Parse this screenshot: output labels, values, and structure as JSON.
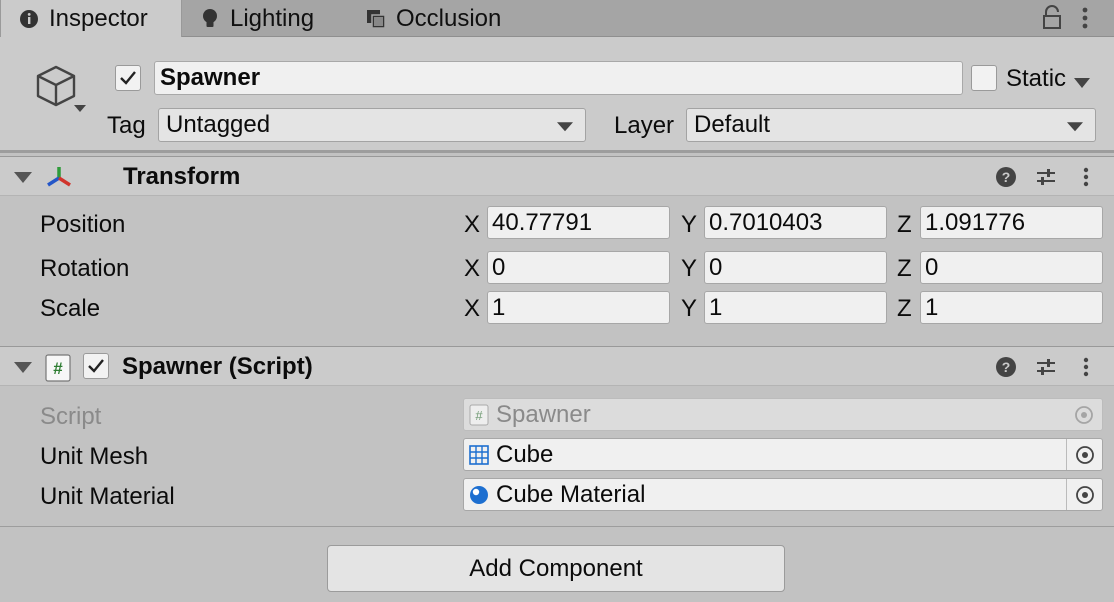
{
  "tabs": [
    {
      "label": "Inspector",
      "icon": "info-icon"
    },
    {
      "label": "Lighting",
      "icon": "bulb-icon"
    },
    {
      "label": "Occlusion",
      "icon": "occlusion-icon"
    }
  ],
  "header": {
    "object_name": "Spawner",
    "active": true,
    "static_label": "Static",
    "static_checked": false,
    "tag_label": "Tag",
    "tag_value": "Untagged",
    "layer_label": "Layer",
    "layer_value": "Default"
  },
  "transform": {
    "title": "Transform",
    "rows": [
      {
        "label": "Position",
        "x": "40.77791",
        "y": "0.7010403",
        "z": "1.091776"
      },
      {
        "label": "Rotation",
        "x": "0",
        "y": "0",
        "z": "0"
      },
      {
        "label": "Scale",
        "x": "1",
        "y": "1",
        "z": "1"
      }
    ],
    "axis_x": "X",
    "axis_y": "Y",
    "axis_z": "Z"
  },
  "spawner_script": {
    "title": "Spawner (Script)",
    "enabled": true,
    "script_label": "Script",
    "script_value": "Spawner",
    "unit_mesh_label": "Unit Mesh",
    "unit_mesh_value": "Cube",
    "unit_material_label": "Unit Material",
    "unit_material_value": "Cube Material"
  },
  "footer": {
    "add_component_label": "Add Component"
  },
  "colors": {
    "accent_blue": "#1d6fd0",
    "script_icon_green": "#2e7d32"
  }
}
